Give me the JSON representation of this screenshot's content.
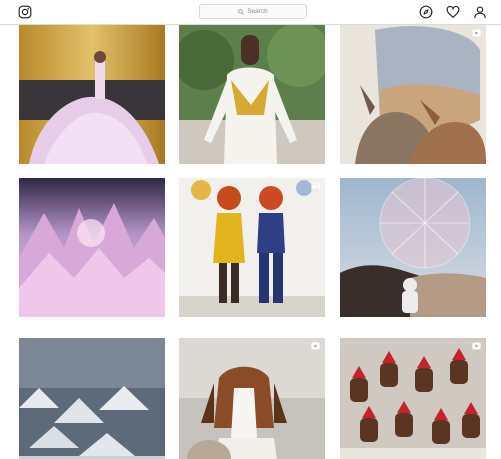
{
  "header": {
    "logo_icon": "instagram-icon",
    "search_placeholder": "Search",
    "icons": [
      "compass-icon",
      "heart-icon",
      "profile-icon"
    ]
  },
  "posts": [
    {
      "kind": "image",
      "subject": "woman-in-pink-ballgown",
      "badge": null
    },
    {
      "kind": "image",
      "subject": "woman-in-white-gold-suit",
      "badge": null
    },
    {
      "kind": "image",
      "subject": "rabbits-airplane-window",
      "badge": "video-icon"
    },
    {
      "kind": "image",
      "subject": "pink-crystal-landscape",
      "badge": null
    },
    {
      "kind": "image",
      "subject": "two-women-retro-outfits",
      "badge": "carousel-icon"
    },
    {
      "kind": "image",
      "subject": "astronaut-geodesic-sphere",
      "badge": null
    },
    {
      "kind": "image",
      "subject": "snowy-village-night",
      "badge": null
    },
    {
      "kind": "image",
      "subject": "beagle-with-hedgehog",
      "badge": "video-icon"
    },
    {
      "kind": "image",
      "subject": "chocolate-santa-desserts",
      "badge": "video-icon"
    }
  ],
  "colors": {
    "border": "#dbdbdb",
    "text_muted": "#8e8e8e",
    "icon": "#262626"
  }
}
